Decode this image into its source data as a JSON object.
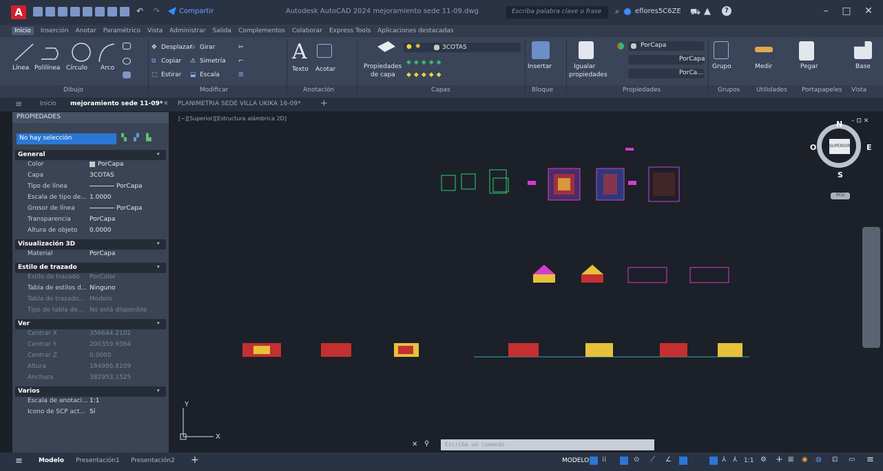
{
  "titlebar": {
    "app_letter": "A",
    "share": "Compartir",
    "title": "Autodesk AutoCAD 2024   mejoramiento sede 11-09.dwg",
    "search_placeholder": "Escriba palabra clave o frase",
    "user": "eflores5C6ZE"
  },
  "ribbon_tabs": [
    "Inicio",
    "Inserción",
    "Anotar",
    "Paramétrico",
    "Vista",
    "Administrar",
    "Salida",
    "Complementos",
    "Colaborar",
    "Express Tools",
    "Aplicaciones destacadas"
  ],
  "ribbon": {
    "dibujo": {
      "linea": "Línea",
      "polilinea": "Polilínea",
      "circulo": "Círculo",
      "arco": "Arco",
      "panel": "Dibujo"
    },
    "modificar": {
      "desplazar": "Desplazar",
      "girar": "Girar",
      "copiar": "Copiar",
      "simetria": "Simetría",
      "estirar": "Estirar",
      "escala": "Escala",
      "panel": "Modificar"
    },
    "anotacion": {
      "texto": "Texto",
      "acotar": "Acotar",
      "panel": "Anotación"
    },
    "capas": {
      "propiedades": "Propiedades",
      "de_capa": "de capa",
      "layer": "3COTAS",
      "panel": "Capas"
    },
    "bloque": {
      "insertar": "Insertar",
      "panel": "Bloque"
    },
    "propiedades": {
      "igualar": "Igualar",
      "propiedades": "propiedades",
      "color": "PorCapa",
      "linetype": "PorCapa",
      "lineweight": "PorCa...",
      "panel": "Propiedades"
    },
    "grupos": {
      "grupo": "Grupo",
      "panel": "Grupos"
    },
    "utilidades": {
      "medir": "Medir",
      "panel": "Utilidades"
    },
    "portapapeles": {
      "pegar": "Pegar",
      "panel": "Portapapeles"
    },
    "vista": {
      "base": "Base",
      "panel": "Vista"
    }
  },
  "doc_tabs": [
    "Inicio",
    "mejoramiento sede 11-09*",
    "PLANIMETRIA SEDE VILLA UKIKA 16-09*"
  ],
  "viewport_label": "[−][Superior][Estructura alámbrica 2D]",
  "properties": {
    "header": "PROPIEDADES",
    "selection": "No hay selección",
    "sections": [
      {
        "name": "General",
        "rows": [
          [
            "Color",
            "PorCapa"
          ],
          [
            "Capa",
            "3COTAS"
          ],
          [
            "Tipo de línea",
            "PorCapa"
          ],
          [
            "Escala de tipo de...",
            "1.0000"
          ],
          [
            "Grosor de línea",
            "PorCapa"
          ],
          [
            "Transparencia",
            "PorCapa"
          ],
          [
            "Altura de objeto",
            "0.0000"
          ]
        ]
      },
      {
        "name": "Visualización 3D",
        "rows": [
          [
            "Material",
            "PorCapa"
          ]
        ]
      },
      {
        "name": "Estilo de trazado",
        "rows": [
          [
            "Estilo de trazado",
            "PorColor"
          ],
          [
            "Tabla de estilos d...",
            "Ninguno"
          ],
          [
            "Tabla de trazado...",
            "Modelo"
          ],
          [
            "Tipo de tabla de...",
            "No está disponible"
          ]
        ]
      },
      {
        "name": "Ver",
        "rows": [
          [
            "Centrar X",
            "356644.2102"
          ],
          [
            "Centrar Y",
            "200359.9364"
          ],
          [
            "Centrar Z",
            "0.0000"
          ],
          [
            "Altura",
            "184986.8109"
          ],
          [
            "Anchura",
            "382953.1525"
          ]
        ]
      },
      {
        "name": "Varios",
        "rows": [
          [
            "Escala de anotaci...",
            "1:1"
          ],
          [
            "Icono de SCP act...",
            "Sí"
          ]
        ]
      }
    ]
  },
  "viewcube": {
    "n": "N",
    "s": "S",
    "e": "E",
    "o": "O",
    "face": "SUPERIOR",
    "wcs": "SCU"
  },
  "ucs": {
    "x": "X",
    "y": "Y"
  },
  "command": {
    "placeholder": "Escriba un comando"
  },
  "status": {
    "model_tab": "Modelo",
    "layout1": "Presentación1",
    "layout2": "Presentación2",
    "mode": "MODELO",
    "scale": "1:1"
  },
  "colors": {
    "accent": "#2b78d4",
    "canvas": "#1c2028",
    "layer_green": "#2fcf6b",
    "magenta": "#d63bd0"
  }
}
